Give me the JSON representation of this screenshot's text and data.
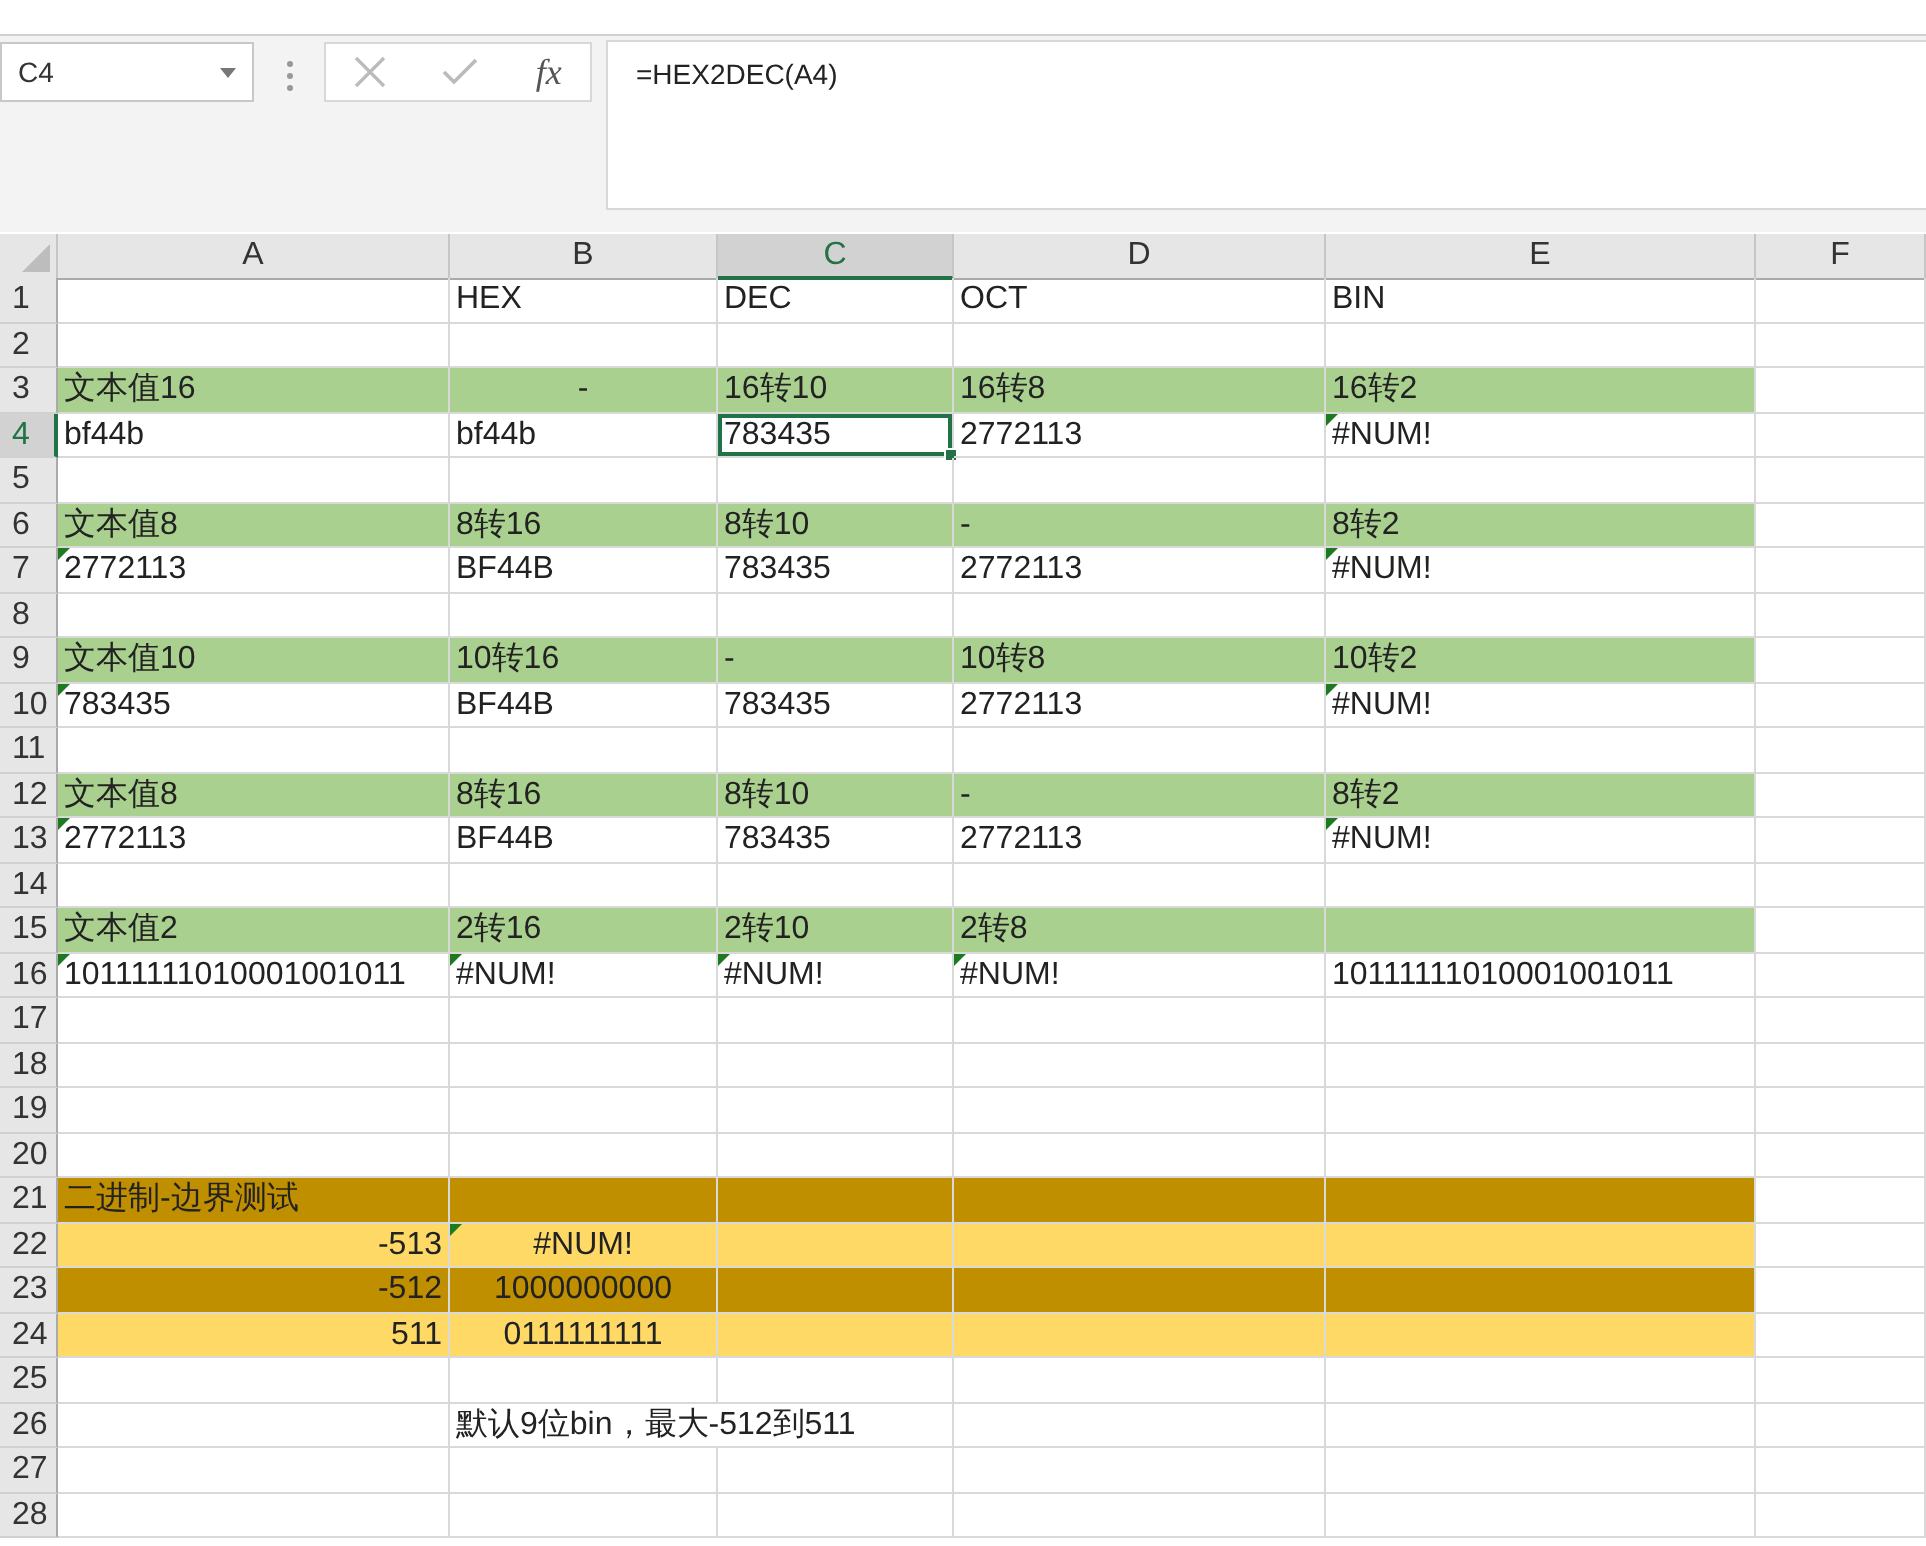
{
  "formula_bar": {
    "name_box": "C4",
    "function_label": "fx",
    "formula": "=HEX2DEC(A4)"
  },
  "columns": [
    {
      "label": "A",
      "selected": false
    },
    {
      "label": "B",
      "selected": false
    },
    {
      "label": "C",
      "selected": true
    },
    {
      "label": "D",
      "selected": false
    },
    {
      "label": "E",
      "selected": false
    },
    {
      "label": "F",
      "selected": false
    }
  ],
  "rows": [
    {
      "number": "1",
      "kind": "plain",
      "selected": false,
      "cells": [
        {
          "kind": "blank"
        },
        {
          "kind": "text",
          "text": "HEX",
          "flagged": false,
          "selected": false
        },
        {
          "kind": "text",
          "text": "DEC",
          "flagged": false,
          "selected": false
        },
        {
          "kind": "text",
          "text": "OCT",
          "flagged": false,
          "selected": false
        },
        {
          "kind": "text",
          "text": "BIN",
          "flagged": false,
          "selected": false
        }
      ]
    },
    {
      "number": "2",
      "kind": "plain",
      "selected": false
    },
    {
      "number": "3",
      "kind": "label",
      "selected": false,
      "cells": [
        {
          "kind": "text",
          "text": "文本值16",
          "flagged": false,
          "selected": false
        },
        {
          "kind": "center",
          "text": "-",
          "flagged": false,
          "selected": false
        },
        {
          "kind": "text",
          "text": "16转10",
          "flagged": false,
          "selected": false
        },
        {
          "kind": "text",
          "text": "16转8",
          "flagged": false,
          "selected": false
        },
        {
          "kind": "text",
          "text": "16转2",
          "flagged": false,
          "selected": false
        }
      ]
    },
    {
      "number": "4",
      "kind": "plain",
      "selected": true,
      "cells": [
        {
          "kind": "text",
          "text": "bf44b",
          "flagged": false,
          "selected": false
        },
        {
          "kind": "text",
          "text": "bf44b",
          "flagged": false,
          "selected": false
        },
        {
          "kind": "text",
          "text": "783435",
          "flagged": false,
          "selected": true
        },
        {
          "kind": "text",
          "text": "2772113",
          "flagged": false,
          "selected": false
        },
        {
          "kind": "text",
          "text": "#NUM!",
          "flagged": true,
          "selected": false
        }
      ]
    },
    {
      "number": "5",
      "kind": "plain",
      "selected": false
    },
    {
      "number": "6",
      "kind": "label",
      "selected": false,
      "cells": [
        {
          "kind": "text",
          "text": "文本值8",
          "flagged": false,
          "selected": false
        },
        {
          "kind": "text",
          "text": "8转16",
          "flagged": false,
          "selected": false
        },
        {
          "kind": "text",
          "text": "8转10",
          "flagged": false,
          "selected": false
        },
        {
          "kind": "text",
          "text": "-",
          "flagged": false,
          "selected": false
        },
        {
          "kind": "text",
          "text": "8转2",
          "flagged": false,
          "selected": false
        }
      ]
    },
    {
      "number": "7",
      "kind": "plain",
      "selected": false,
      "cells": [
        {
          "kind": "text",
          "text": "2772113",
          "flagged": true,
          "selected": false
        },
        {
          "kind": "text",
          "text": "BF44B",
          "flagged": false,
          "selected": false
        },
        {
          "kind": "text",
          "text": "783435",
          "flagged": false,
          "selected": false
        },
        {
          "kind": "text",
          "text": "2772113",
          "flagged": false,
          "selected": false
        },
        {
          "kind": "text",
          "text": "#NUM!",
          "flagged": true,
          "selected": false
        }
      ]
    },
    {
      "number": "8",
      "kind": "plain",
      "selected": false
    },
    {
      "number": "9",
      "kind": "label",
      "selected": false,
      "cells": [
        {
          "kind": "text",
          "text": "文本值10",
          "flagged": false,
          "selected": false
        },
        {
          "kind": "text",
          "text": "10转16",
          "flagged": false,
          "selected": false
        },
        {
          "kind": "text",
          "text": "-",
          "flagged": false,
          "selected": false
        },
        {
          "kind": "text",
          "text": "10转8",
          "flagged": false,
          "selected": false
        },
        {
          "kind": "text",
          "text": "10转2",
          "flagged": false,
          "selected": false
        }
      ]
    },
    {
      "number": "10",
      "kind": "plain",
      "selected": false,
      "cells": [
        {
          "kind": "text",
          "text": "783435",
          "flagged": true,
          "selected": false
        },
        {
          "kind": "text",
          "text": "BF44B",
          "flagged": false,
          "selected": false
        },
        {
          "kind": "text",
          "text": "783435",
          "flagged": false,
          "selected": false
        },
        {
          "kind": "text",
          "text": "2772113",
          "flagged": false,
          "selected": false
        },
        {
          "kind": "text",
          "text": "#NUM!",
          "flagged": true,
          "selected": false
        }
      ]
    },
    {
      "number": "11",
      "kind": "plain",
      "selected": false
    },
    {
      "number": "12",
      "kind": "label",
      "selected": false,
      "cells": [
        {
          "kind": "text",
          "text": "文本值8",
          "flagged": false,
          "selected": false
        },
        {
          "kind": "text",
          "text": "8转16",
          "flagged": false,
          "selected": false
        },
        {
          "kind": "text",
          "text": "8转10",
          "flagged": false,
          "selected": false
        },
        {
          "kind": "text",
          "text": "-",
          "flagged": false,
          "selected": false
        },
        {
          "kind": "text",
          "text": "8转2",
          "flagged": false,
          "selected": false
        }
      ]
    },
    {
      "number": "13",
      "kind": "plain",
      "selected": false,
      "cells": [
        {
          "kind": "text",
          "text": "2772113",
          "flagged": true,
          "selected": false
        },
        {
          "kind": "text",
          "text": "BF44B",
          "flagged": false,
          "selected": false
        },
        {
          "kind": "text",
          "text": "783435",
          "flagged": false,
          "selected": false
        },
        {
          "kind": "text",
          "text": "2772113",
          "flagged": false,
          "selected": false
        },
        {
          "kind": "text",
          "text": "#NUM!",
          "flagged": true,
          "selected": false
        }
      ]
    },
    {
      "number": "14",
      "kind": "plain",
      "selected": false
    },
    {
      "number": "15",
      "kind": "label",
      "selected": false,
      "cells": [
        {
          "kind": "text",
          "text": " 文本值2",
          "flagged": false,
          "selected": false
        },
        {
          "kind": "text",
          "text": "2转16",
          "flagged": false,
          "selected": false
        },
        {
          "kind": "text",
          "text": "2转10",
          "flagged": false,
          "selected": false
        },
        {
          "kind": "text",
          "text": "2转8",
          "flagged": false,
          "selected": false
        },
        {
          "kind": "blank"
        }
      ]
    },
    {
      "number": "16",
      "kind": "plain",
      "selected": false,
      "cells": [
        {
          "kind": "text",
          "text": "10111111010001001011",
          "flagged": true,
          "selected": false
        },
        {
          "kind": "text",
          "text": "#NUM!",
          "flagged": true,
          "selected": false
        },
        {
          "kind": "text",
          "text": "#NUM!",
          "flagged": true,
          "selected": false
        },
        {
          "kind": "text",
          "text": "#NUM!",
          "flagged": true,
          "selected": false
        },
        {
          "kind": "text",
          "text": "10111111010001001011",
          "flagged": false,
          "selected": false
        }
      ]
    },
    {
      "number": "17",
      "kind": "plain",
      "selected": false
    },
    {
      "number": "18",
      "kind": "plain",
      "selected": false
    },
    {
      "number": "19",
      "kind": "plain",
      "selected": false
    },
    {
      "number": "20",
      "kind": "plain",
      "selected": false
    },
    {
      "number": "21",
      "kind": "dark",
      "selected": false,
      "cells": [
        {
          "kind": "text",
          "text": "二进制-边界测试",
          "flagged": false,
          "selected": false
        }
      ]
    },
    {
      "number": "22",
      "kind": "light",
      "selected": false,
      "cells": [
        {
          "kind": "right",
          "text": "-513",
          "flagged": false,
          "selected": false
        },
        {
          "kind": "center",
          "text": "#NUM!",
          "flagged": true,
          "selected": false
        }
      ]
    },
    {
      "number": "23",
      "kind": "dark",
      "selected": false,
      "cells": [
        {
          "kind": "right",
          "text": "-512",
          "flagged": false,
          "selected": false
        },
        {
          "kind": "center",
          "text": "1000000000",
          "flagged": false,
          "selected": false
        }
      ]
    },
    {
      "number": "24",
      "kind": "light",
      "selected": false,
      "cells": [
        {
          "kind": "right",
          "text": "511",
          "flagged": false,
          "selected": false
        },
        {
          "kind": "center",
          "text": "0111111111",
          "flagged": false,
          "selected": false
        }
      ]
    },
    {
      "number": "25",
      "kind": "plain",
      "selected": false
    },
    {
      "number": "26",
      "kind": "plain",
      "selected": false,
      "cells": [
        {
          "kind": "blank"
        },
        {
          "kind": "text",
          "text": "默认9位bin，最大-512到511",
          "flagged": false,
          "selected": false
        }
      ]
    },
    {
      "number": "27",
      "kind": "plain",
      "selected": false
    },
    {
      "number": "28",
      "kind": "plain",
      "selected": false
    }
  ]
}
